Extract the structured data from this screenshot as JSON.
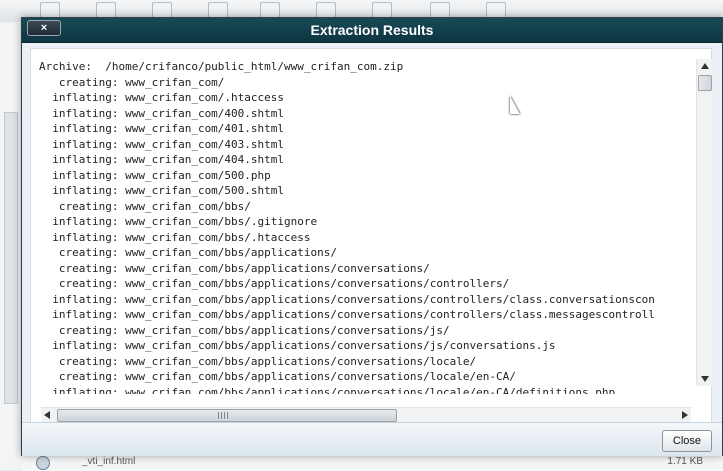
{
  "modal": {
    "title": "Extraction Results",
    "close_x_label": "×",
    "footer": {
      "close_label": "Close"
    }
  },
  "log": {
    "lines": [
      "Archive:  /home/crifanco/public_html/www_crifan_com.zip",
      "   creating: www_crifan_com/",
      "  inflating: www_crifan_com/.htaccess",
      "  inflating: www_crifan_com/400.shtml",
      "  inflating: www_crifan_com/401.shtml",
      "  inflating: www_crifan_com/403.shtml",
      "  inflating: www_crifan_com/404.shtml",
      "  inflating: www_crifan_com/500.php",
      "  inflating: www_crifan_com/500.shtml",
      "   creating: www_crifan_com/bbs/",
      "  inflating: www_crifan_com/bbs/.gitignore",
      "  inflating: www_crifan_com/bbs/.htaccess",
      "   creating: www_crifan_com/bbs/applications/",
      "   creating: www_crifan_com/bbs/applications/conversations/",
      "   creating: www_crifan_com/bbs/applications/conversations/controllers/",
      "  inflating: www_crifan_com/bbs/applications/conversations/controllers/class.conversationscon",
      "  inflating: www_crifan_com/bbs/applications/conversations/controllers/class.messagescontroll",
      "   creating: www_crifan_com/bbs/applications/conversations/js/",
      "  inflating: www_crifan_com/bbs/applications/conversations/js/conversations.js",
      "   creating: www_crifan_com/bbs/applications/conversations/locale/",
      "   creating: www_crifan_com/bbs/applications/conversations/locale/en-CA/",
      "  inflating: www_crifan_com/bbs/applications/conversations/locale/en-CA/definitions.php"
    ]
  },
  "background": {
    "bottom_filename": "_vti_inf.html",
    "bottom_size": "1.71 KB"
  },
  "colors": {
    "titlebar": "#0e3441",
    "modal_bg": "#eaf0f5",
    "text": "#222222"
  }
}
